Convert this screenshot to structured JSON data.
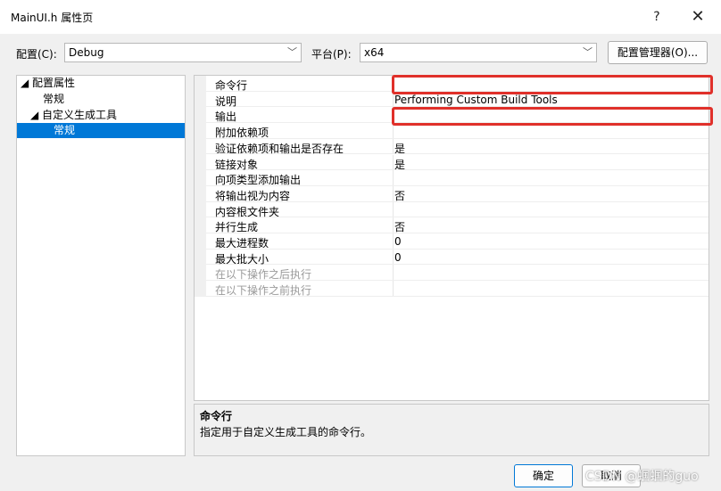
{
  "window": {
    "title": "MainUI.h 属性页",
    "help_label": "?",
    "close_label": "✕"
  },
  "config_bar": {
    "config_label": "配置(C):",
    "config_value": "Debug",
    "platform_label": "平台(P):",
    "platform_value": "x64",
    "manager_button": "配置管理器(O)..."
  },
  "tree": {
    "items": [
      {
        "label": "◢ 配置属性"
      },
      {
        "label": "常规"
      },
      {
        "label": "◢ 自定义生成工具"
      },
      {
        "label": "常规"
      }
    ]
  },
  "properties": [
    {
      "name": "命令行",
      "value": ""
    },
    {
      "name": "说明",
      "value": "Performing Custom Build Tools"
    },
    {
      "name": "输出",
      "value": ""
    },
    {
      "name": "附加依赖项",
      "value": ""
    },
    {
      "name": "验证依赖项和输出是否存在",
      "value": "是"
    },
    {
      "name": "链接对象",
      "value": "是"
    },
    {
      "name": "向项类型添加输出",
      "value": ""
    },
    {
      "name": "将输出视为内容",
      "value": "否"
    },
    {
      "name": "内容根文件夹",
      "value": ""
    },
    {
      "name": "并行生成",
      "value": "否"
    },
    {
      "name": "最大进程数",
      "value": "0"
    },
    {
      "name": "最大批大小",
      "value": "0"
    },
    {
      "name": "在以下操作之后执行",
      "value": ""
    },
    {
      "name": "在以下操作之前执行",
      "value": ""
    }
  ],
  "description": {
    "title": "命令行",
    "text": "指定用于自定义生成工具的命令行。"
  },
  "buttons": {
    "ok": "确定",
    "cancel": "取消"
  },
  "watermark": "CSDN @蝈蝈的guo",
  "colors": {
    "highlight": "#e0302a",
    "selection": "#0078d7"
  }
}
